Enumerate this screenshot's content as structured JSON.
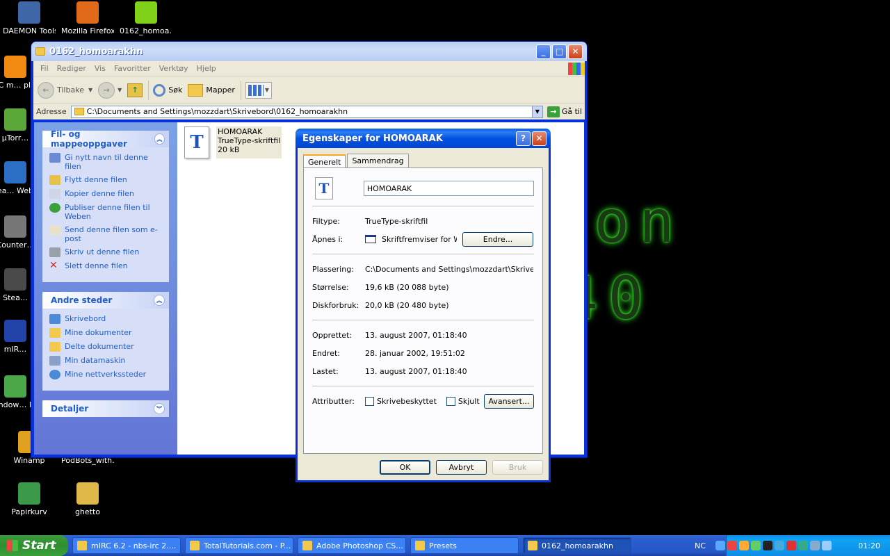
{
  "desktop": {
    "wallpaper_lines": [
      "ion",
      "40"
    ],
    "icons": [
      {
        "label": "DAEMON Tools",
        "icon": "daemon-tools-icon",
        "color": "#3f67a8"
      },
      {
        "label": "Mozilla Firefox",
        "icon": "firefox-icon",
        "color": "#e06a1a"
      },
      {
        "label": "0162_homoa…",
        "icon": "archive-icon",
        "color": "#7fd11a"
      },
      {
        "label": "VLC m… play…",
        "icon": "vlc-icon",
        "color": "#f28a12"
      },
      {
        "label": "µTorr…",
        "icon": "utorrent-icon",
        "color": "#5aa83a"
      },
      {
        "label": "Crea… WebCam…",
        "icon": "webcam-icon",
        "color": "#2a6fc4"
      },
      {
        "label": "Counter…",
        "icon": "counter-strike-icon",
        "color": "#777777"
      },
      {
        "label": "Stea…",
        "icon": "steam-icon",
        "color": "#4a4a4a"
      },
      {
        "label": "mIR…",
        "icon": "mirc-icon",
        "color": "#2244aa"
      },
      {
        "label": "Window… Messe…",
        "icon": "messenger-icon",
        "color": "#4aa84a"
      },
      {
        "label": "Winamp",
        "icon": "winamp-icon",
        "color": "#e0a020"
      },
      {
        "label": "PodBots_with…",
        "icon": "podbots-icon",
        "color": "#000000"
      },
      {
        "label": "Papirkurv",
        "icon": "recycle-bin-icon",
        "color": "#3a9a4a"
      },
      {
        "label": "ghetto",
        "icon": "cd-icon",
        "color": "#e0b84a"
      }
    ]
  },
  "explorer": {
    "title": "0162_homoarakhn",
    "menu": [
      "Fil",
      "Rediger",
      "Vis",
      "Favoritter",
      "Verktøy",
      "Hjelp"
    ],
    "toolbar": {
      "back": "Tilbake",
      "search": "Søk",
      "folders": "Mapper"
    },
    "address_label": "Adresse",
    "address_value": "C:\\Documents and Settings\\mozzdart\\Skrivebord\\0162_homoarakhn",
    "go_label": "Gå til",
    "file_tasks": {
      "title": "Fil- og mappeoppgaver",
      "items": [
        "Gi nytt navn til denne filen",
        "Flytt denne filen",
        "Kopier denne filen",
        "Publiser denne filen til Weben",
        "Send denne filen som e-post",
        "Skriv ut denne filen",
        "Slett denne filen"
      ]
    },
    "other_places": {
      "title": "Andre steder",
      "items": [
        "Skrivebord",
        "Mine dokumenter",
        "Delte dokumenter",
        "Min datamaskin",
        "Mine nettverkssteder"
      ]
    },
    "details_title": "Detaljer",
    "file": {
      "name": "HOMOARAK",
      "type": "TrueType-skriftfil",
      "size": "20 kB"
    }
  },
  "dialog": {
    "title": "Egenskaper for HOMOARAK",
    "tabs": [
      "Generelt",
      "Sammendrag"
    ],
    "name_value": "HOMOARAK",
    "filetype_label": "Filtype:",
    "filetype_value": "TrueType-skriftfil",
    "opens_label": "Åpnes i:",
    "opens_value": "Skriftfremviser for Wir",
    "change_button": "Endre...",
    "location_label": "Plassering:",
    "location_value": "C:\\Documents and Settings\\mozzdart\\Skrivebord\\(",
    "size_label": "Størrelse:",
    "size_value": "19,6 kB (20 088 byte)",
    "disk_label": "Diskforbruk:",
    "disk_value": "20,0 kB (20 480 byte)",
    "created_label": "Opprettet:",
    "created_value": "13. august 2007, 01:18:40",
    "modified_label": "Endret:",
    "modified_value": "28. januar 2002, 19:51:02",
    "accessed_label": "Lastet:",
    "accessed_value": "13. august 2007, 01:18:40",
    "attributes_label": "Attributter:",
    "readonly_label": "Skrivebeskyttet",
    "hidden_label": "Skjult",
    "advanced_button": "Avansert...",
    "ok_button": "OK",
    "cancel_button": "Avbryt",
    "apply_button": "Bruk"
  },
  "taskbar": {
    "start_label": "Start",
    "buttons": [
      {
        "label": "mIRC 6.2 - nbs-irc 2....",
        "icon": "mirc-task-icon"
      },
      {
        "label": "TotalTutorials.com - P...",
        "icon": "firefox-task-icon"
      },
      {
        "label": "Adobe Photoshop CS...",
        "icon": "photoshop-task-icon"
      },
      {
        "label": "Presets",
        "icon": "folder-task-icon"
      },
      {
        "label": "0162_homoarakhn",
        "icon": "folder-task-icon",
        "active": true
      }
    ],
    "lang": "NC",
    "clock": "01:20"
  }
}
